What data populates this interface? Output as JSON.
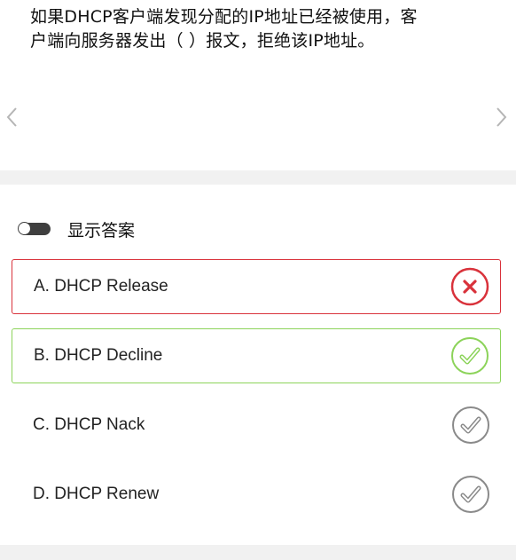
{
  "question": {
    "line1": "如果DHCP客户端发现分配的IP地址已经被使用，客",
    "line2": "户端向服务器发出（ ）报文，拒绝该IP地址。"
  },
  "navigation": {
    "prev_icon": "chevron-left-icon",
    "next_icon": "chevron-right-icon"
  },
  "answer_toggle": {
    "label": "显示答案",
    "state": "off"
  },
  "options": [
    {
      "text": "A. DHCP Release",
      "status": "wrong",
      "icon": "x-circle-icon"
    },
    {
      "text": "B. DHCP Decline",
      "status": "correct",
      "icon": "check-circle-icon"
    },
    {
      "text": "C. DHCP Nack",
      "status": "neutral",
      "icon": "check-circle-icon"
    },
    {
      "text": "D. DHCP Renew",
      "status": "neutral",
      "icon": "check-circle-icon"
    }
  ],
  "colors": {
    "wrong": "#d9323b",
    "correct": "#8cd35a",
    "neutral": "#8a8a8a",
    "background": "#f1f1f1"
  }
}
